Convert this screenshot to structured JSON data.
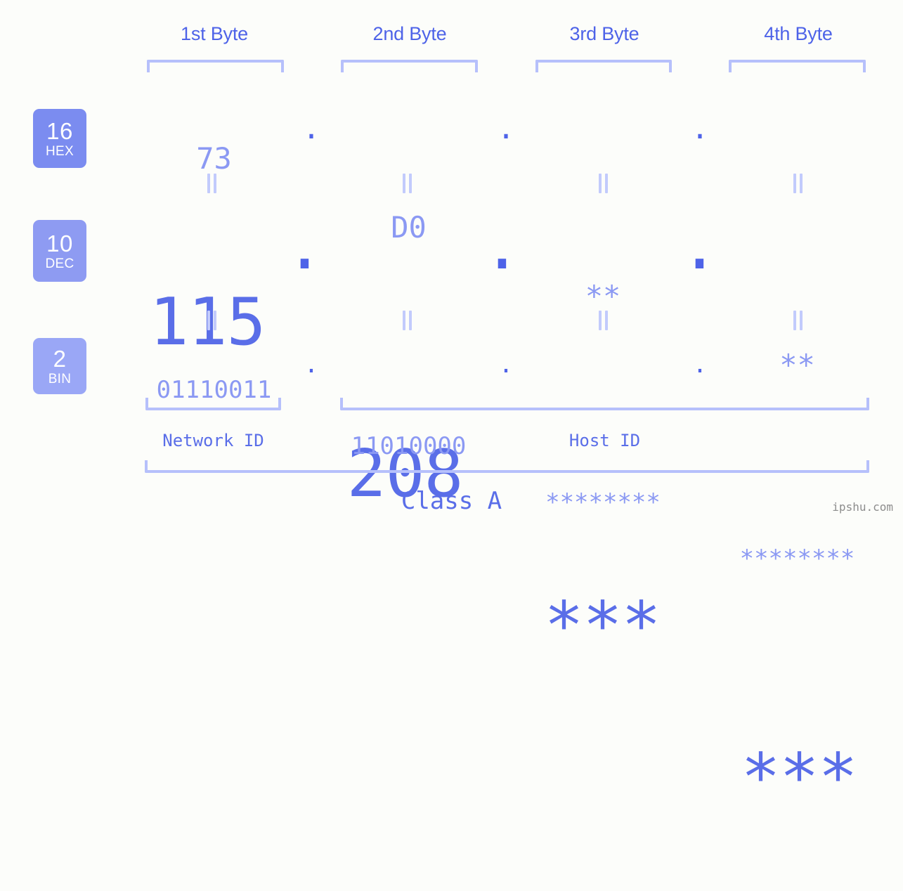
{
  "background_color": "#fcfdfa",
  "accent_color": "#5a6ee8",
  "accent_light_color": "#8b99f3",
  "bracket_color": "#b6c0fb",
  "byte_headers": [
    {
      "label": "1st Byte"
    },
    {
      "label": "2nd Byte"
    },
    {
      "label": "3rd Byte"
    },
    {
      "label": "4th Byte"
    }
  ],
  "bases": [
    {
      "number": "16",
      "name": "HEX",
      "color": "#7b8cf0"
    },
    {
      "number": "10",
      "name": "DEC",
      "color": "#8e9bf2"
    },
    {
      "number": "2",
      "name": "BIN",
      "color": "#9aa7f6"
    }
  ],
  "rows": {
    "hex": {
      "base_number": "16",
      "base_name": "HEX",
      "octets": [
        "73",
        "D0",
        "**",
        "**"
      ],
      "separator": "."
    },
    "dec": {
      "base_number": "10",
      "base_name": "DEC",
      "octets": [
        "115",
        "208",
        "***",
        "***"
      ],
      "separator": "."
    },
    "bin": {
      "base_number": "2",
      "base_name": "BIN",
      "octets": [
        "01110011",
        "11010000",
        "********",
        "********"
      ],
      "separator": "."
    }
  },
  "equals_marks": {
    "glyph": "||",
    "count_per_gap": 4,
    "gaps": 2
  },
  "segments": {
    "network_id": "Network ID",
    "host_id": "Host ID"
  },
  "class_label": "Class A",
  "watermark": "ipshu.com"
}
